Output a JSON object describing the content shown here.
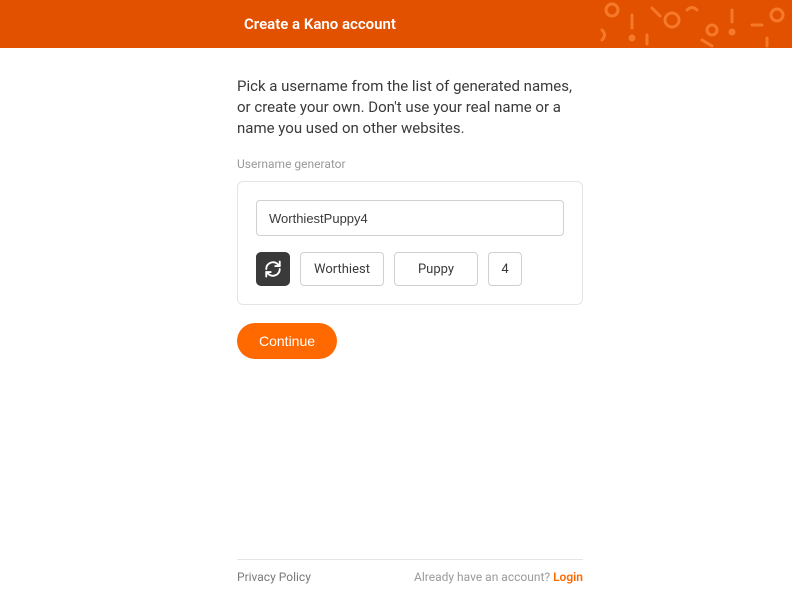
{
  "header": {
    "title": "Create a Kano account"
  },
  "main": {
    "instructions": "Pick a username from the list of generated names, or create your own. Don't use your real name or a name you used on other websites.",
    "generator_label": "Username generator",
    "username_value": "WorthiestPuppy4",
    "segments": {
      "word1": "Worthiest",
      "word2": "Puppy",
      "number": "4"
    },
    "continue_label": "Continue"
  },
  "footer": {
    "privacy_label": "Privacy Policy",
    "already_text": "Already have an account? ",
    "login_label": "Login"
  },
  "colors": {
    "brand_orange": "#ff6900",
    "header_orange": "#e25100",
    "dark_gray": "#3a3a3a"
  }
}
